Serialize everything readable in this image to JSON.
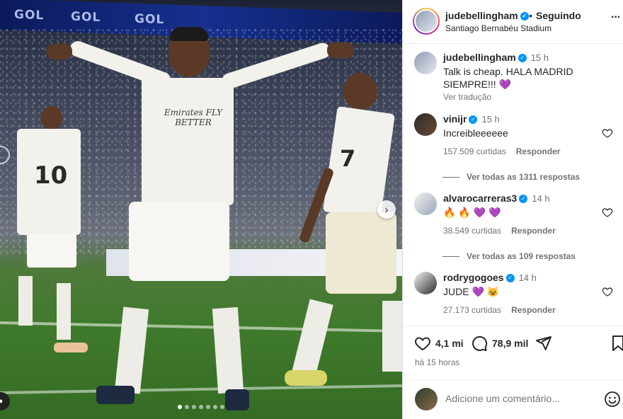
{
  "photo": {
    "led_text": [
      "GOL",
      "GOL",
      "GOL"
    ],
    "sponsor_text": "Emirates FLY BETTER",
    "back_number_left": "10",
    "back_number_right": "7",
    "carousel": {
      "total": 7,
      "active_index": 0
    }
  },
  "header": {
    "username": "judebellingham",
    "separator": "•",
    "follow_label": "Seguindo",
    "location": "Santiago Bernabéu Stadium",
    "more_label": "···"
  },
  "caption": {
    "username": "judebellingham",
    "time": "15 h",
    "text": "Talk is cheap. HALA MADRID SIEMPRE!!! 💜",
    "translate": "Ver tradução"
  },
  "comments": [
    {
      "username": "vinijr",
      "time": "15 h",
      "text": "Increibleeeeee",
      "likes": "157.509 curtidas",
      "reply_label": "Responder",
      "view_replies": "Ver todas as 1311 respostas"
    },
    {
      "username": "alvarocarreras3",
      "time": "14 h",
      "text": "🔥 🔥 💜 💜",
      "likes": "38.549 curtidas",
      "reply_label": "Responder",
      "view_replies": "Ver todas as 109 respostas"
    },
    {
      "username": "rodrygogoes",
      "time": "14 h",
      "text": "JUDE 💜 😺",
      "likes": "27.173 curtidas",
      "reply_label": "Responder"
    }
  ],
  "actions": {
    "likes": "4,1 mi",
    "comments": "78,9 mil",
    "posted": "há 15 horas"
  },
  "comment_bar": {
    "placeholder": "Adicione um comentário..."
  },
  "icons": {
    "verified": "verified-badge-icon",
    "like": "heart-icon",
    "comment": "comment-bubble-icon",
    "share": "paper-plane-icon",
    "save": "bookmark-icon",
    "emoji": "smiley-icon",
    "next": "chevron-right-icon"
  },
  "colors": {
    "verified": "#0095f6",
    "secondary_text": "#737373",
    "primary_text": "#262626"
  }
}
